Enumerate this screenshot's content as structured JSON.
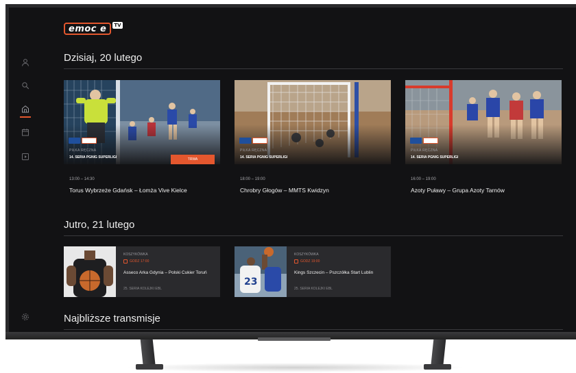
{
  "app": {
    "logo_text": "emoc e",
    "logo_tv": "TV",
    "accent_color": "#e4572e"
  },
  "sidebar": {
    "items": [
      {
        "icon": "user-icon"
      },
      {
        "icon": "search-icon"
      },
      {
        "icon": "home-icon",
        "active": true
      },
      {
        "icon": "calendar-icon"
      },
      {
        "icon": "play-icon"
      },
      {
        "icon": "gear-icon"
      }
    ]
  },
  "today": {
    "heading": "Dzisiaj, 20 lutego",
    "cards": [
      {
        "category": "PIŁKA RĘCZNA",
        "series": "14. SERIA PGNIG SUPERLIGI",
        "live_label": "TRWA",
        "time": "13:00 – 14:30",
        "title": "Torus Wybrzeże Gdańsk – Łomża Vive Kielce"
      },
      {
        "category": "PIŁKA RĘCZNA",
        "series": "14. SERIA PGNIG SUPERLIGI",
        "time": "18:00 – 19:00",
        "title": "Chrobry Głogów – MMTS Kwidzyn"
      },
      {
        "category": "PIŁKA RĘCZNA",
        "series": "14. SERIA PGNIG SUPERLIGI",
        "time": "16:00 – 19:00",
        "title": "Azoty Puławy – Grupa Azoty Tarnów"
      }
    ]
  },
  "tomorrow": {
    "heading": "Jutro, 21 lutego",
    "cards": [
      {
        "category": "KOSZYKÓWKA",
        "time": "GODZ 17:00",
        "title": "Asseco Arka Gdynia – Polski Cukier Toruń",
        "series": "25. SERIA KOLEJKI EBL"
      },
      {
        "category": "KOSZYKÓWKA",
        "time": "GODZ 19:00",
        "title": "Kings Szczecin – Pszczółka Start Lublin",
        "series": "25. SERIA KOLEJKI EBL"
      }
    ]
  },
  "upcoming": {
    "heading": "Najbliższe transmisje"
  }
}
